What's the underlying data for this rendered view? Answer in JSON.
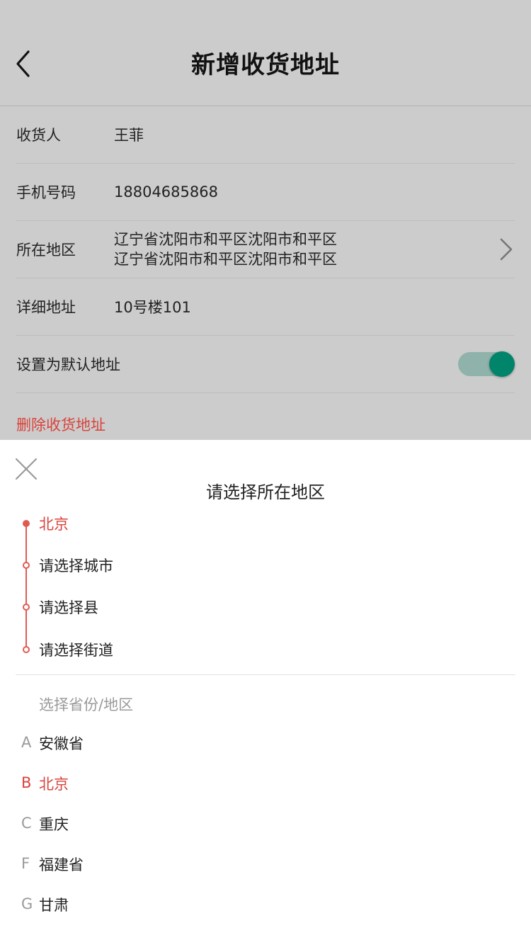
{
  "header": {
    "title": "新增收货地址"
  },
  "form": {
    "receiver": {
      "label": "收货人",
      "value": "王菲"
    },
    "phone": {
      "label": "手机号码",
      "value": "18804685868"
    },
    "region": {
      "label": "所在地区",
      "value_line1": "辽宁省沈阳市和平区沈阳市和平区",
      "value_line2": "辽宁省沈阳市和平区沈阳市和平区"
    },
    "detail": {
      "label": "详细地址",
      "value": "10号楼101"
    },
    "default": {
      "label": "设置为默认地址",
      "enabled": true
    },
    "delete_label": "删除收货地址"
  },
  "sheet": {
    "title": "请选择所在地区",
    "steps": [
      {
        "label": "北京",
        "active": true
      },
      {
        "label": "请选择城市",
        "active": false
      },
      {
        "label": "请选择县",
        "active": false
      },
      {
        "label": "请选择街道",
        "active": false
      }
    ],
    "section_title": "选择省份/地区",
    "regions": [
      {
        "letter": "A",
        "name": "安徽省",
        "selected": false
      },
      {
        "letter": "B",
        "name": "北京",
        "selected": true
      },
      {
        "letter": "C",
        "name": "重庆",
        "selected": false
      },
      {
        "letter": "F",
        "name": "福建省",
        "selected": false
      },
      {
        "letter": "G",
        "name": "甘肃",
        "selected": false
      }
    ]
  },
  "colors": {
    "accent_red": "#d9433c",
    "toggle_on": "#00856a",
    "toggle_track": "#8fb2aa",
    "overlay_gray": "#cccccc"
  },
  "icons": {
    "back": "chevron-left-icon",
    "region_arrow": "chevron-right-icon",
    "close": "close-icon"
  }
}
